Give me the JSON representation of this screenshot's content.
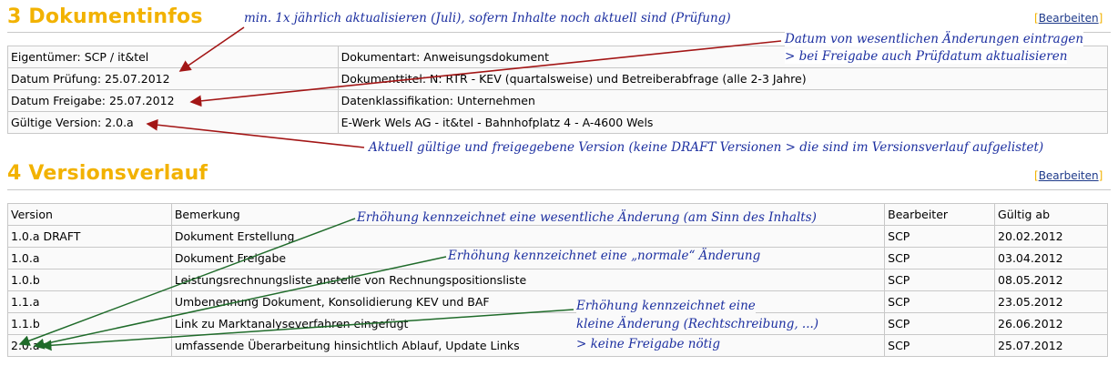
{
  "section3": {
    "heading": "3 Dokumentinfos",
    "edit_label": "Bearbeiten",
    "rows": [
      [
        "Eigentümer: SCP / it&tel",
        "Dokumentart: Anweisungsdokument"
      ],
      [
        "Datum Prüfung: 25.07.2012",
        "Dokumenttitel: N: RTR - KEV (quartalsweise) und Betreiberabfrage (alle 2-3 Jahre)"
      ],
      [
        "Datum Freigabe: 25.07.2012",
        "Datenklassifikation: Unternehmen"
      ],
      [
        "Gültige Version: 2.0.a",
        "E-Werk Wels AG - it&tel - Bahnhofplatz 4 - A-4600 Wels"
      ]
    ]
  },
  "section4": {
    "heading": "4 Versionsverlauf",
    "edit_label": "Bearbeiten",
    "columns": [
      "Version",
      "Bemerkung",
      "Bearbeiter",
      "Gültig ab"
    ],
    "rows": [
      [
        "1.0.a DRAFT",
        "Dokument Erstellung",
        "SCP",
        "20.02.2012"
      ],
      [
        "1.0.a",
        "Dokument Freigabe",
        "SCP",
        "03.04.2012"
      ],
      [
        "1.0.b",
        "Leistungsrechnungsliste anstelle von Rechnungspositionsliste",
        "SCP",
        "08.05.2012"
      ],
      [
        "1.1.a",
        "Umbenennung Dokument, Konsolidierung KEV und BAF",
        "SCP",
        "23.05.2012"
      ],
      [
        "1.1.b",
        "Link zu Marktanalyseverfahren eingefügt",
        "SCP",
        "26.06.2012"
      ],
      [
        "2.0.a",
        "umfassende Überarbeitung hinsichtlich Ablauf, Update Links",
        "SCP",
        "25.07.2012"
      ]
    ]
  },
  "annotations": {
    "pruefung": "min. 1x jährlich aktualisieren (Juli), sofern Inhalte noch aktuell sind (Prüfung)",
    "datum_1": "Datum von wesentlichen Änderungen eintragen",
    "datum_2": "> bei Freigabe auch Prüfdatum aktualisieren",
    "version": "Aktuell gültige und freigegebene Version (keine DRAFT Versionen > die sind im Versionsverlauf aufgelistet)",
    "wesentlich": "Erhöhung kennzeichnet eine wesentliche Änderung (am Sinn des Inhalts)",
    "normal": "Erhöhung kennzeichnet eine „normale“ Änderung",
    "klein_1": "Erhöhung kennzeichnet eine",
    "klein_2": "kleine Änderung (Rechtschreibung, ...)",
    "klein_3": "> keine Freigabe nötig"
  },
  "colors": {
    "heading": "#f2b200",
    "annotation_text": "#1c2fa0",
    "arrow_red": "#a31616",
    "arrow_green": "#1f6b2a"
  }
}
